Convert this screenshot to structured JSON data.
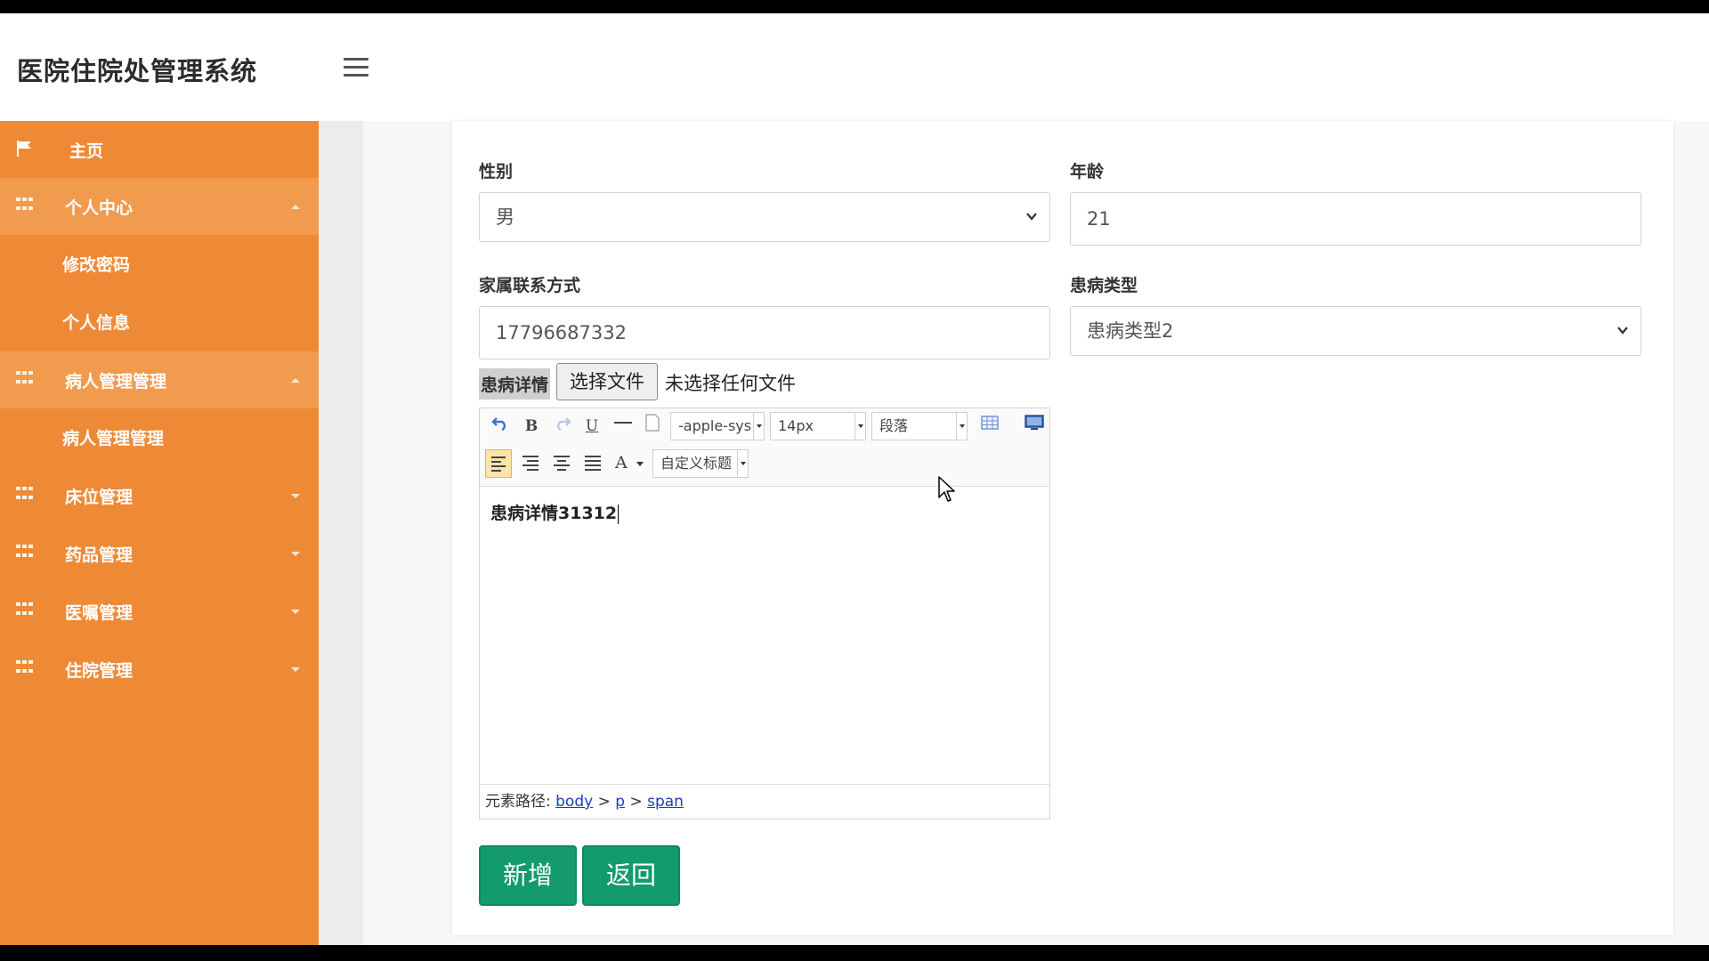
{
  "header": {
    "brand": "医院住院处管理系统"
  },
  "sidebar": {
    "items": [
      {
        "label": "主页"
      },
      {
        "label": "个人中心",
        "sub": [
          "修改密码",
          "个人信息"
        ]
      },
      {
        "label": "病人管理管理",
        "sub": [
          "病人管理管理"
        ]
      },
      {
        "label": "床位管理"
      },
      {
        "label": "药品管理"
      },
      {
        "label": "医嘱管理"
      },
      {
        "label": "住院管理"
      }
    ]
  },
  "form": {
    "gender": {
      "label": "性别",
      "value": "男"
    },
    "age": {
      "label": "年龄",
      "value": "21"
    },
    "family_contact": {
      "label": "家属联系方式",
      "value": "17796687332"
    },
    "disease_type": {
      "label": "患病类型",
      "value": "患病类型2"
    },
    "disease_detail": {
      "label": "患病详情",
      "file_button": "选择文件",
      "file_status": "未选择任何文件"
    }
  },
  "editor": {
    "toolbar": {
      "font_family": "-apple-sys",
      "font_size": "14px",
      "paragraph": "段落",
      "custom_heading": "自定义标题",
      "bold": "B",
      "underline": "U",
      "font_color": "A"
    },
    "content": "患病详情31312",
    "path_label": "元素路径:",
    "path": [
      "body",
      "p",
      "span"
    ]
  },
  "actions": {
    "add": "新增",
    "back": "返回"
  },
  "colors": {
    "sidebar_bg": "#ee8a36",
    "sidebar_open": "#f19b4f",
    "primary_button": "#139b6c"
  }
}
